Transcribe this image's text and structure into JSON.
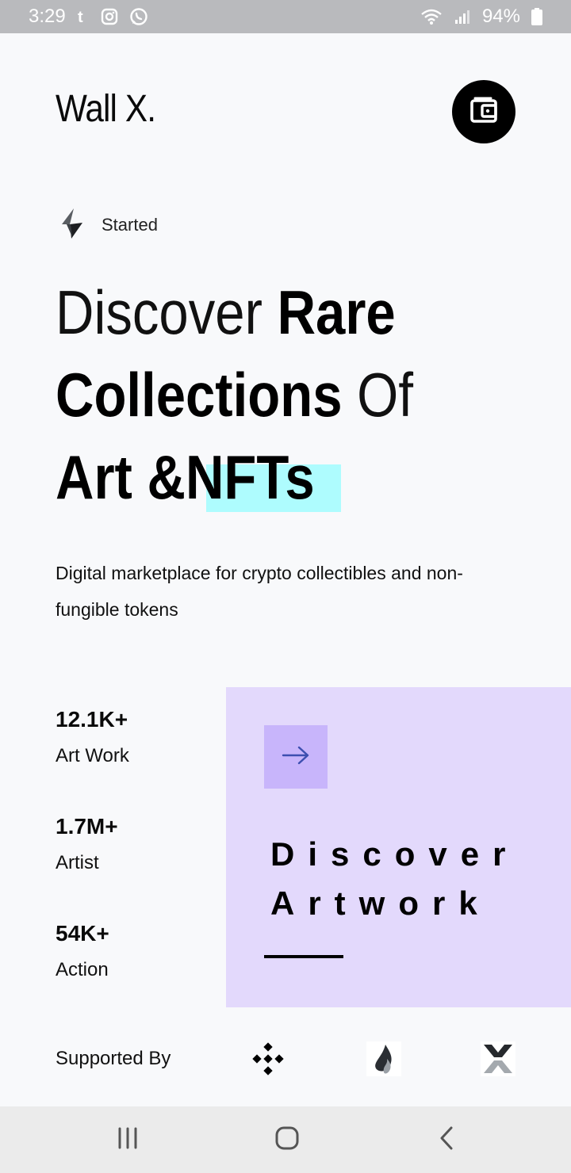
{
  "status_bar": {
    "time": "3:29",
    "battery": "94%",
    "icons": [
      "tumblr-icon",
      "instagram-icon",
      "whatsapp-icon",
      "wifi-icon",
      "signal-icon",
      "battery-icon"
    ]
  },
  "header": {
    "logo": "Wall X.",
    "wallet_icon": "wallet-icon"
  },
  "hero": {
    "tag_icon": "lightning-icon",
    "tag_label": "Started",
    "headline": {
      "line1_light": "Discover ",
      "line1_bold": "Rare",
      "line2_bold": "Collections",
      "line2_light": " Of",
      "line3_bold": "Art &NFTs"
    },
    "highlight_color": "#aefcfe",
    "description": "Digital marketplace for crypto collectibles and non-fungible tokens"
  },
  "stats": [
    {
      "value": "12.1K+",
      "label": "Art Work"
    },
    {
      "value": "1.7M+",
      "label": "Artist"
    },
    {
      "value": "54K+",
      "label": "Action"
    }
  ],
  "discover": {
    "line1": "Discover",
    "line2": "Artwork",
    "arrow_icon": "arrow-right-icon",
    "panel_color": "#e3d9fc",
    "button_color": "#c8b5fb"
  },
  "supported": {
    "label": "Supported By",
    "partners": [
      "binance-icon",
      "huobi-icon",
      "x-exchange-icon"
    ]
  },
  "nav": {
    "icons": [
      "recent-apps-icon",
      "home-icon",
      "back-icon"
    ]
  }
}
